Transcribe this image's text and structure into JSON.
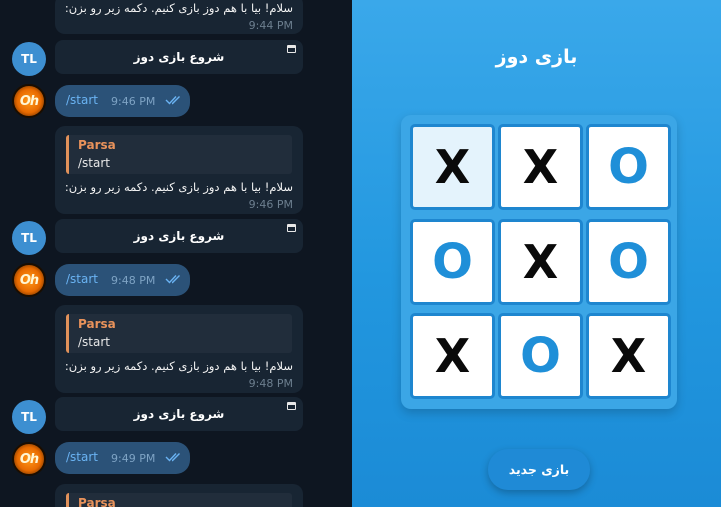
{
  "chat": {
    "messages": [
      {
        "type": "bot",
        "text": "سلام! بیا با هم دوز بازی کنیم. دکمه زیر رو بزن:",
        "time": "9:44 PM",
        "button": "شروع بازی دوز",
        "avatar": "TL"
      },
      {
        "type": "user",
        "text": "/start",
        "time": "9:46 PM",
        "avatar": "Oh"
      },
      {
        "type": "bot",
        "quote_name": "Parsa",
        "quote_text": "/start",
        "text": "سلام! بیا با هم دوز بازی کنیم. دکمه زیر رو بزن:",
        "time": "9:46 PM",
        "button": "شروع بازی دوز",
        "avatar": "TL"
      },
      {
        "type": "user",
        "text": "/start",
        "time": "9:48 PM",
        "avatar": "Oh"
      },
      {
        "type": "bot",
        "quote_name": "Parsa",
        "quote_text": "/start",
        "text": "سلام! بیا با هم دوز بازی کنیم. دکمه زیر رو بزن:",
        "time": "9:48 PM",
        "button": "شروع بازی دوز",
        "avatar": "TL"
      },
      {
        "type": "user",
        "text": "/start",
        "time": "9:49 PM",
        "avatar": "Oh"
      },
      {
        "type": "bot",
        "quote_name": "Parsa"
      }
    ]
  },
  "game": {
    "title": "بازی دوز",
    "board": [
      [
        "X",
        "X",
        "O"
      ],
      [
        "O",
        "X",
        "O"
      ],
      [
        "X",
        "O",
        "X"
      ]
    ],
    "new_game_label": "بازی جدید"
  },
  "colors": {
    "chat_bg": "#0e1621",
    "bubble_in": "#182533",
    "bubble_out": "#2b5278",
    "quote_accent": "#e8925b",
    "game_bg": "#2297df",
    "o_color": "#1f8fd8"
  }
}
